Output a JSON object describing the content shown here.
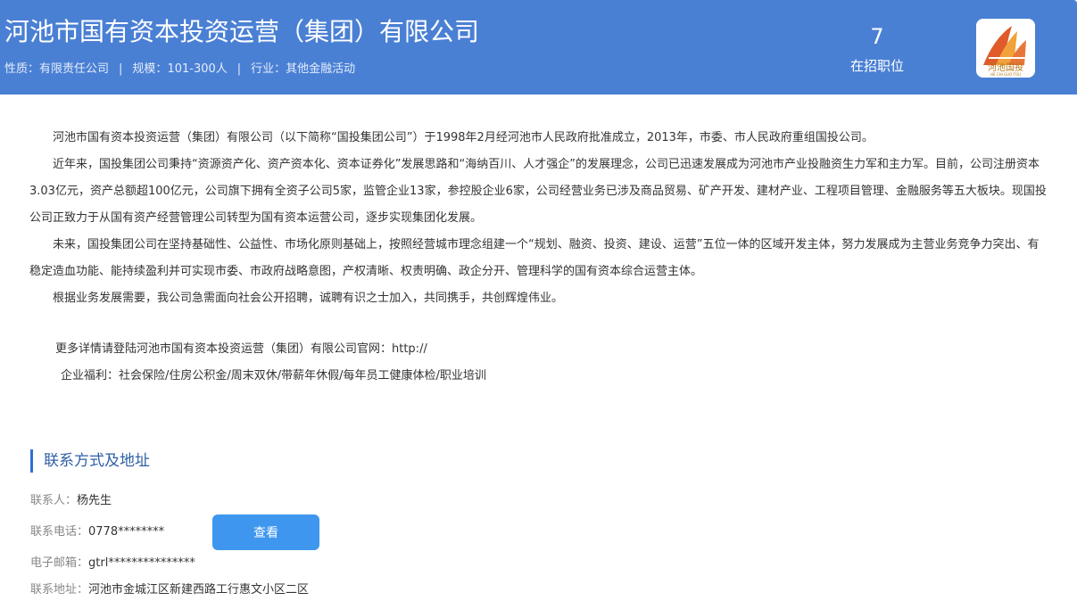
{
  "header": {
    "company_name": "河池市国有资本投资运营（集团）有限公司",
    "meta": {
      "nature_label": "性质：",
      "nature": "有限责任公司",
      "scale_label": "规模：",
      "scale": "101-300人",
      "industry_label": "行业：",
      "industry": "其他金融活动",
      "separator": "|"
    },
    "job_count": "7",
    "job_count_label": "在招职位",
    "logo": {
      "icon": "company-logo",
      "text": "河池国投",
      "subtext": "HE CHI GUO TOU",
      "colors": {
        "red": "#e05a2a",
        "orange": "#f2a23a",
        "text": "#b5761a"
      }
    }
  },
  "description": {
    "paragraphs": [
      "河池市国有资本投资运营（集团）有限公司（以下简称“国投集团公司”）于1998年2月经河池市人民政府批准成立，2013年，市委、市人民政府重组国投公司。",
      "近年来，国投集团公司秉持“资源资产化、资产资本化、资本证券化”发展思路和“海纳百川、人才强企”的发展理念，公司已迅速发展成为河池市产业投融资生力军和主力军。目前，公司注册资本3.03亿元，资产总额超100亿元，公司旗下拥有全资子公司5家，监管企业13家，参控股企业6家，公司经营业务已涉及商品贸易、矿产开发、建材产业、工程项目管理、金融服务等五大板块。现国投公司正致力于从国有资产经营管理公司转型为国有资本运营公司，逐步实现集团化发展。",
      "未来，国投集团公司在坚持基础性、公益性、市场化原则基础上，按照经营城市理念组建一个“规划、融资、投资、建设、运营”五位一体的区域开发主体，努力发展成为主营业务竞争力突出、有稳定造血功能、能持续盈利并可实现市委、市政府战略意图，产权清晰、权责明确、政企分开、管理科学的国有资本综合运营主体。",
      "根据业务发展需要，我公司急需面向社会公开招聘，诚聘有识之士加入，共同携手，共创辉煌伟业。"
    ],
    "website_line": "更多详情请登陆河池市国有资本投资运营（集团）有限公司官网：http://",
    "welfare_line": "企业福利：社会保险/住房公积金/周末双休/带薪年休假/每年员工健康体检/职业培训"
  },
  "contact": {
    "section_title": "联系方式及地址",
    "person_label": "联系人：",
    "person": "杨先生",
    "phone_label": "联系电话：",
    "phone": "0778********",
    "view_button": "查看",
    "email_label": "电子邮箱：",
    "email": "gtrl***************",
    "address_label": "联系地址：",
    "address": "河池市金城江区新建西路工行惠文小区二区"
  },
  "colors": {
    "header_bg": "#4a80d4",
    "accent": "#2f6fd0",
    "button_bg": "#3e96ee"
  }
}
